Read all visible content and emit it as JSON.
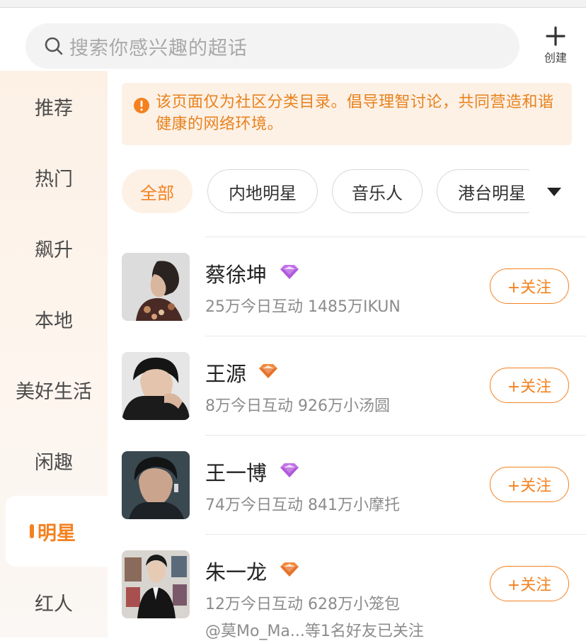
{
  "search": {
    "placeholder": "搜索你感兴趣的超话"
  },
  "create": {
    "label": "创建"
  },
  "sidebar": {
    "items": [
      {
        "label": "推荐",
        "active": false
      },
      {
        "label": "热门",
        "active": false
      },
      {
        "label": "飙升",
        "active": false
      },
      {
        "label": "本地",
        "active": false
      },
      {
        "label": "美好生活",
        "active": false
      },
      {
        "label": "闲趣",
        "active": false
      },
      {
        "label": "明星",
        "active": true
      },
      {
        "label": "红人",
        "active": false
      }
    ]
  },
  "notice": {
    "text": "该页面仅为社区分类目录。倡导理智讨论，共同营造和谐健康的网络环境。"
  },
  "filters": {
    "chips": [
      {
        "label": "全部",
        "active": true
      },
      {
        "label": "内地明星",
        "active": false
      },
      {
        "label": "音乐人",
        "active": false
      },
      {
        "label": "港台明星",
        "active": false
      }
    ]
  },
  "topics": [
    {
      "name": "蔡徐坤",
      "gem": "purple",
      "stats": "25万今日互动 1485万IKUN",
      "follow_label": "+关注"
    },
    {
      "name": "王源",
      "gem": "orange",
      "stats": "8万今日互动 926万小汤圆",
      "follow_label": "+关注"
    },
    {
      "name": "王一博",
      "gem": "purple",
      "stats": "74万今日互动 841万小摩托",
      "follow_label": "+关注"
    },
    {
      "name": "朱一龙",
      "gem": "orange",
      "stats": "12万今日互动 628万小笼包",
      "friends": "@莫Mo_Ma...等1名好友已关注",
      "follow_label": "+关注"
    }
  ],
  "colors": {
    "accent": "#f4811f",
    "gem_purple": "#b45ce0",
    "gem_orange": "#f07a2a"
  }
}
